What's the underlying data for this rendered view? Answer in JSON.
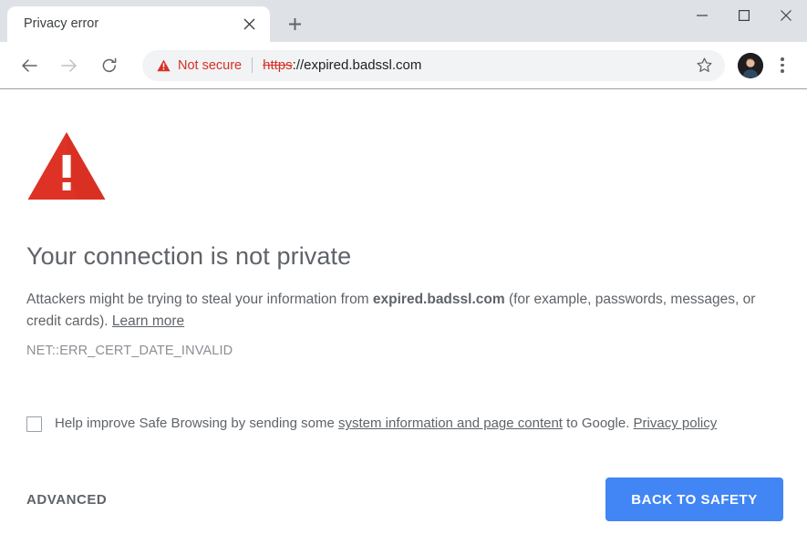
{
  "window": {
    "controls": {
      "minimize_label": "Minimize",
      "maximize_label": "Maximize",
      "close_label": "Close"
    }
  },
  "tabstrip": {
    "tabs": [
      {
        "title": "Privacy error",
        "close_label": "Close tab"
      }
    ],
    "new_tab_label": "New tab"
  },
  "toolbar": {
    "back_label": "Back",
    "forward_label": "Forward",
    "reload_label": "Reload",
    "security": {
      "status_text": "Not secure",
      "status_color": "#d93025",
      "icon": "warning-triangle-icon"
    },
    "url": {
      "scheme": "https",
      "rest": "://expired.badssl.com",
      "full": "https://expired.badssl.com"
    },
    "bookmark_label": "Bookmark this tab",
    "profile_label": "Profile",
    "menu_label": "Customize and control Google Chrome"
  },
  "interstitial": {
    "icon": "warning-triangle-icon",
    "icon_color": "#de3226",
    "heading": "Your connection is not private",
    "body": {
      "prefix": "Attackers might be trying to steal your information from ",
      "domain": "expired.badssl.com",
      "suffix": " (for example, passwords, messages, or credit cards). ",
      "learn_more": "Learn more"
    },
    "error_code": "NET::ERR_CERT_DATE_INVALID",
    "safe_browsing": {
      "checked": false,
      "prefix": "Help improve Safe Browsing by sending some ",
      "link1": "system information and page content",
      "middle": " to Google. ",
      "link2": "Privacy policy"
    },
    "advanced_button": "ADVANCED",
    "primary_button": "BACK TO SAFETY",
    "primary_button_color": "#4285f4"
  }
}
